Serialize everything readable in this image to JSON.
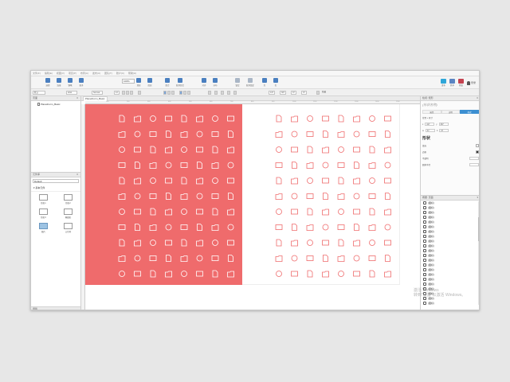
{
  "menubar": {
    "items": [
      "文件(F)",
      "编辑(E)",
      "视图(V)",
      "项目(P)",
      "布局(A)",
      "发布(U)",
      "团队(T)",
      "账户(C)",
      "帮助(H)"
    ]
  },
  "toolbar": {
    "tools": [
      {
        "label": "选择",
        "icon": "select-icon"
      },
      {
        "label": "连接",
        "icon": "connect-icon"
      },
      {
        "label": "钢笔",
        "icon": "pen-icon"
      },
      {
        "label": "更多",
        "icon": "more-icon"
      },
      {
        "label": "顶层",
        "icon": "bring-front-icon"
      },
      {
        "label": "底层",
        "icon": "send-back-icon"
      },
      {
        "label": "组合",
        "icon": "group-icon"
      },
      {
        "label": "取消组合",
        "icon": "ungroup-icon"
      },
      {
        "label": "对齐",
        "icon": "align-icon"
      },
      {
        "label": "分布",
        "icon": "distribute-icon"
      },
      {
        "label": "锁定",
        "icon": "lock-icon"
      },
      {
        "label": "取消锁定",
        "icon": "unlock-icon"
      },
      {
        "label": "左",
        "icon": "left-icon"
      },
      {
        "label": "右",
        "icon": "right-icon"
      }
    ],
    "zoom": "100%",
    "account": [
      {
        "label": "发布",
        "icon": "publish-icon",
        "color": "#2fa6d8"
      },
      {
        "label": "共享",
        "icon": "share-icon",
        "color": "#5a84c2"
      },
      {
        "label": "预览",
        "icon": "preview-icon",
        "color": "#c4424f"
      }
    ],
    "login_label": "登录"
  },
  "formatbar": {
    "style": "默认",
    "font": "Arial",
    "weight": "Normal",
    "size": "13",
    "x": "417",
    "y": "307",
    "w": "37",
    "h": "37",
    "hidden_label": "隐藏"
  },
  "pages_panel": {
    "title": "页面",
    "page_name": "PlanetForm_Basic"
  },
  "library_panel": {
    "title": "元件库",
    "selected": "Default",
    "section": "基本元件",
    "widgets": [
      {
        "label": "矩形1",
        "kind": "box"
      },
      {
        "label": "矩形2",
        "kind": "box"
      },
      {
        "label": "矩形3",
        "kind": "box"
      },
      {
        "label": "椭圆形",
        "kind": "box"
      },
      {
        "label": "图片",
        "kind": "img"
      },
      {
        "label": "占位符",
        "kind": "box"
      }
    ],
    "footer": "母版"
  },
  "canvas": {
    "tab_label": "PlanetForm_Basic",
    "ruler_ticks": [
      "100",
      "200",
      "300",
      "400",
      "500",
      "600",
      "700",
      "800",
      "900",
      "1000",
      "1100",
      "1200",
      "1300",
      "1400",
      "1500"
    ],
    "red_color": "#ef6b6c",
    "icon_rows": 11,
    "icon_cols": 8
  },
  "inspector": {
    "header": "检视: 矩形",
    "title": "(形状名称)",
    "tabs": [
      "属性",
      "说明",
      "样式"
    ],
    "location_label": "位置 + 尺寸",
    "x": "417",
    "y": "307",
    "w": "37",
    "h": "37",
    "shape_label": "形状",
    "fill_label": "填充",
    "border_label": "边框",
    "opacity_label": "不透明",
    "radius_label": "圆角半径"
  },
  "outline": {
    "header": "概要: 页面",
    "rows": [
      "(图标)",
      "(图标)",
      "(图标)",
      "(图标)",
      "(图标)",
      "(图标)",
      "(图标)",
      "(图标)",
      "(图标)",
      "(图标)",
      "(图标)",
      "(图标)",
      "(图标)",
      "(图标)",
      "(图标)",
      "(图标)",
      "(图标)",
      "(图标)",
      "(图标)",
      "(图标)",
      "(图标)",
      "(图标)"
    ]
  },
  "watermark": [
    "激活 Windows",
    "转到\"设置\"以激活 Windows。"
  ]
}
